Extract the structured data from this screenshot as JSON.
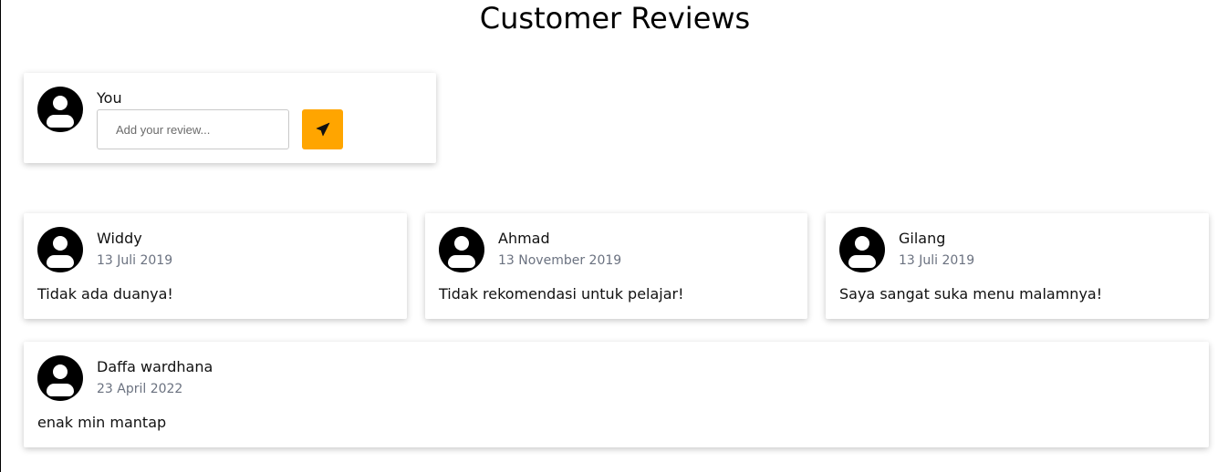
{
  "page": {
    "title": "Customer Reviews"
  },
  "composer": {
    "user_name": "You",
    "input_placeholder": "Add your review...",
    "input_value": "",
    "send_icon": "paper-plane-icon",
    "accent_color": "#ffa500"
  },
  "reviews": [
    {
      "name": "Widdy",
      "date": "13 Juli 2019",
      "text": "Tidak ada duanya!"
    },
    {
      "name": "Ahmad",
      "date": "13 November 2019",
      "text": "Tidak rekomendasi untuk pelajar!"
    },
    {
      "name": "Gilang",
      "date": "13 Juli 2019",
      "text": "Saya sangat suka menu malamnya!"
    },
    {
      "name": "Daffa wardhana",
      "date": "23 April 2022",
      "text": "enak min mantap"
    }
  ]
}
